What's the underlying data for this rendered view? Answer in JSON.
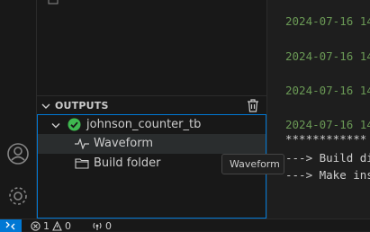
{
  "sidebar": {
    "outputs_title": "OUTPUTS",
    "tree": {
      "root_label": "johnson_counter_tb",
      "children": [
        "Waveform",
        "Build folder"
      ]
    }
  },
  "tooltip": "Waveform",
  "terminal": {
    "lines": [
      "2024-07-16 14",
      "2024-07-16 14",
      "2024-07-16 14",
      "2024-07-16 14",
      "************",
      "---> Build di",
      "---> Make ins"
    ]
  },
  "statusbar": {
    "errors": "1",
    "warnings": "0",
    "ports": "0"
  },
  "colors": {
    "accent": "#0078d4",
    "success": "#3fb950",
    "terminal_timestamp": "#6a9955"
  }
}
